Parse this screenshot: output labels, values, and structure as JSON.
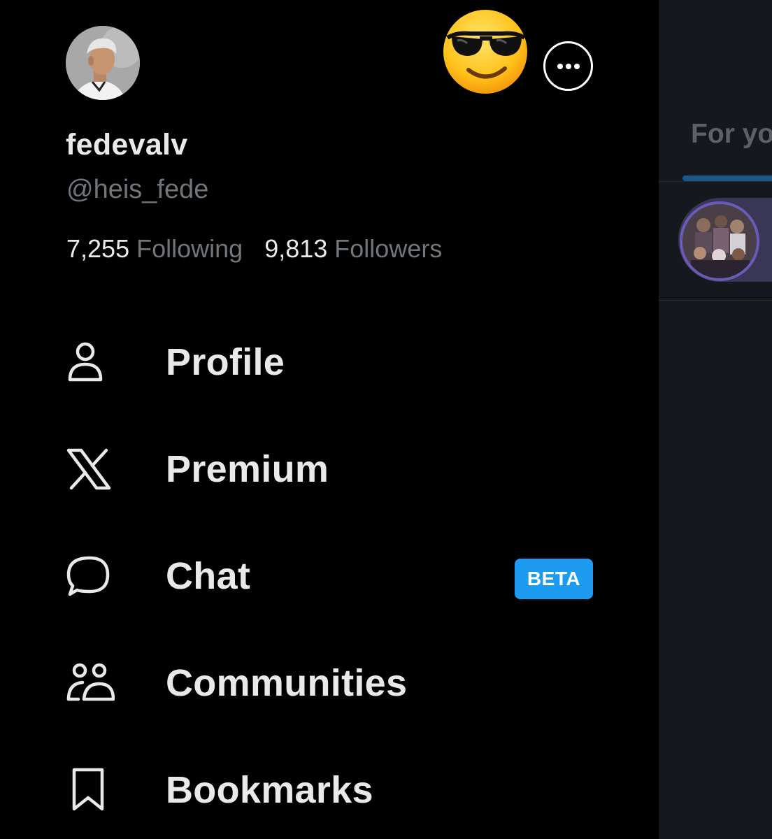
{
  "profile": {
    "display_name": "fedevalv",
    "handle": "@heis_fede",
    "following_count": "7,255",
    "following_label": "Following",
    "followers_count": "9,813",
    "followers_label": "Followers"
  },
  "header": {
    "status_emoji": "😎",
    "more_icon": "more-horizontal-icon"
  },
  "menu": [
    {
      "label": "Profile",
      "icon": "person-icon"
    },
    {
      "label": "Premium",
      "icon": "x-logo-icon"
    },
    {
      "label": "Chat",
      "icon": "chat-bubble-icon",
      "badge": "BETA"
    },
    {
      "label": "Communities",
      "icon": "people-icon"
    },
    {
      "label": "Bookmarks",
      "icon": "bookmark-icon"
    }
  ],
  "background": {
    "tab_label": "For yo"
  },
  "colors": {
    "background": "#000000",
    "primary_text": "#e7e9ea",
    "secondary_text": "#71767b",
    "accent": "#1d9bf0"
  }
}
